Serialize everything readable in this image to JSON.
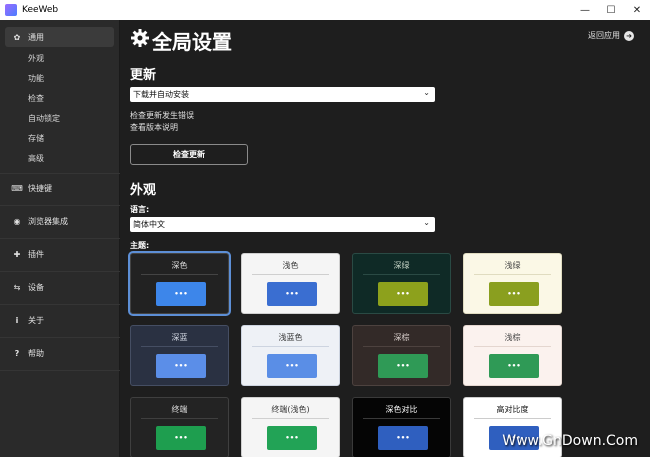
{
  "window": {
    "title": "KeeWeb",
    "minimize": "—",
    "maximize": "☐",
    "close": "✕"
  },
  "sidebar": {
    "general": {
      "label": "通用",
      "icon": "gear-icon"
    },
    "sub_items": [
      "外观",
      "功能",
      "检查",
      "自动锁定",
      "存储",
      "高级"
    ],
    "items": [
      {
        "label": "快捷键",
        "icon": "keyboard-icon"
      },
      {
        "label": "浏览器集成",
        "icon": "chrome-icon"
      },
      {
        "label": "插件",
        "icon": "puzzle-icon"
      },
      {
        "label": "设备",
        "icon": "usb-icon"
      },
      {
        "label": "关于",
        "icon": "info-icon"
      },
      {
        "label": "帮助",
        "icon": "question-icon"
      }
    ]
  },
  "header": {
    "title": "全局设置",
    "return_label": "返回应用"
  },
  "updates": {
    "title": "更新",
    "select_value": "下载并自动安装",
    "status_error": "检查更新发生错误",
    "release_notes": "查看版本说明",
    "check_button": "检查更新"
  },
  "appearance": {
    "title": "外观",
    "language_label": "语言:",
    "language_value": "简体中文",
    "theme_label": "主题:"
  },
  "themes": [
    {
      "name": "深色",
      "bg": "#222222",
      "fg": "#e0e0e0",
      "line": "#444444",
      "btn": "#3d86ea",
      "selected": true
    },
    {
      "name": "浅色",
      "bg": "#f5f5f5",
      "fg": "#333333",
      "line": "#cfcfcf",
      "btn": "#3a6ed1",
      "selected": false
    },
    {
      "name": "深绿",
      "bg": "#0f2a26",
      "fg": "#c8d6c8",
      "line": "#2a4a44",
      "btn": "#8da11c",
      "selected": false
    },
    {
      "name": "浅绿",
      "bg": "#fbf8e6",
      "fg": "#444444",
      "line": "#e0dcc0",
      "btn": "#8a9f1f",
      "selected": false
    },
    {
      "name": "深蓝",
      "bg": "#2a3142",
      "fg": "#d6dbe6",
      "line": "#454e63",
      "btn": "#5b8ee8",
      "selected": false
    },
    {
      "name": "浅蓝色",
      "bg": "#eef1f6",
      "fg": "#333333",
      "line": "#cdd4e0",
      "btn": "#5a8ee6",
      "selected": false
    },
    {
      "name": "深棕",
      "bg": "#332a28",
      "fg": "#dcd2cf",
      "line": "#4d423f",
      "btn": "#2f9a56",
      "selected": false
    },
    {
      "name": "浅棕",
      "bg": "#fbf2ee",
      "fg": "#444444",
      "line": "#e4d6cf",
      "btn": "#2f9a56",
      "selected": false
    },
    {
      "name": "终端",
      "bg": "#232323",
      "fg": "#e0e0e0",
      "line": "#3f3f3f",
      "btn": "#1e9e4f",
      "selected": false
    },
    {
      "name": "终端(浅色)",
      "bg": "#f5f5f5",
      "fg": "#333333",
      "line": "#d0d0d0",
      "btn": "#22a356",
      "selected": false
    },
    {
      "name": "深色对比",
      "bg": "#050505",
      "fg": "#ffffff",
      "line": "#3a3a3a",
      "btn": "#2f5fbf",
      "selected": false
    },
    {
      "name": "高对比度",
      "bg": "#ffffff",
      "fg": "#111111",
      "line": "#cccccc",
      "btn": "#2f5fbf",
      "selected": false
    }
  ],
  "theme_button_glyph": "•••",
  "watermark": "Www.GnDown.Com"
}
